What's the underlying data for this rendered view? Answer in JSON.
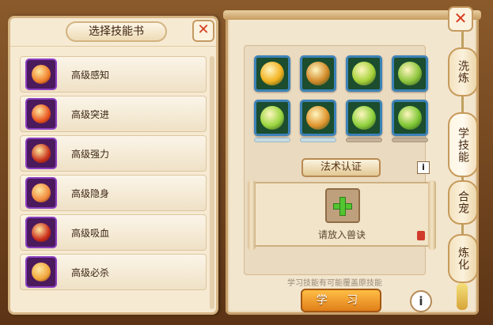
{
  "left_panel": {
    "title": "选择技能书",
    "close_icon": "close-icon",
    "books": [
      {
        "name": "高级感知",
        "icon": "sense-skill-icon",
        "color": "#f07f2a"
      },
      {
        "name": "高级突进",
        "icon": "charge-skill-icon",
        "color": "#e8541f"
      },
      {
        "name": "高级强力",
        "icon": "power-skill-icon",
        "color": "#c7331d"
      },
      {
        "name": "高级隐身",
        "icon": "stealth-skill-icon",
        "color": "#f08a3d"
      },
      {
        "name": "高级吸血",
        "icon": "bloodsuck-skill-icon",
        "color": "#c92d1b"
      },
      {
        "name": "高级必杀",
        "icon": "critical-skill-icon",
        "color": "#f0a43a"
      }
    ]
  },
  "right_panel": {
    "skills": [
      {
        "icon": "fire-skull-icon",
        "color": "#f2b21f"
      },
      {
        "icon": "demon-claw-icon",
        "color": "#d38b2a"
      },
      {
        "icon": "green-vortex-icon",
        "color": "#a7d23a"
      },
      {
        "icon": "bat-icon",
        "color": "#8ec63d"
      },
      {
        "icon": "green-wings-icon",
        "color": "#9ad640"
      },
      {
        "icon": "horned-demon-icon",
        "color": "#e0962f"
      },
      {
        "icon": "green-slash-icon",
        "color": "#8fd13d"
      },
      {
        "icon": "green-heart-icon",
        "color": "#7ec734"
      }
    ],
    "cert_button": "法术认证",
    "info_small": "i",
    "put_label": "请放入兽诀",
    "hint": "学习技能有可能覆盖原技能",
    "learn_button": "学 习",
    "info_big": "i"
  },
  "tabs": [
    {
      "label": "洗炼",
      "active": false
    },
    {
      "label": "学技能",
      "active": true
    },
    {
      "label": "合宠",
      "active": false
    },
    {
      "label": "炼化",
      "active": false
    }
  ],
  "close_main": "close-icon"
}
